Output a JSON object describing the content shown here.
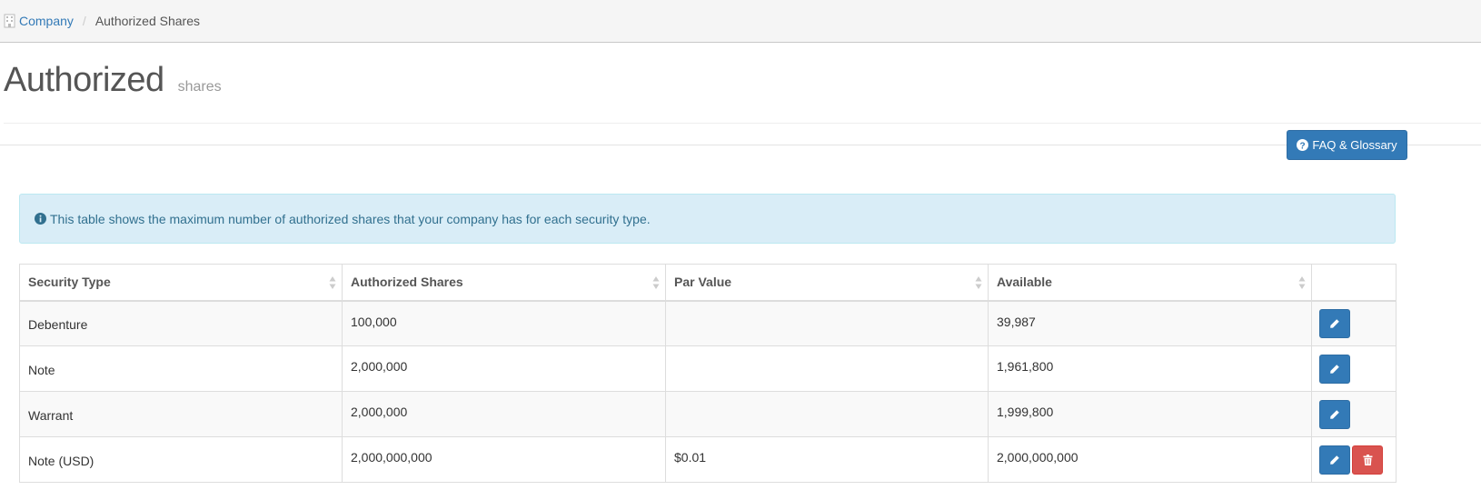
{
  "breadcrumb": {
    "icon": "building-icon",
    "company_label": "Company",
    "separator": "/",
    "current_label": "Authorized Shares"
  },
  "page": {
    "title": "Authorized",
    "subtitle": "shares"
  },
  "faq_button": {
    "icon": "question-circle-icon",
    "label": "FAQ & Glossary"
  },
  "info_alert": {
    "icon": "info-circle-icon",
    "text": "This table shows the maximum number of authorized shares that your company has for each security type."
  },
  "table": {
    "columns": [
      "Security Type",
      "Authorized Shares",
      "Par Value",
      "Available",
      ""
    ],
    "rows": [
      {
        "security_type": "Debenture",
        "authorized_shares": "100,000",
        "par_value": "",
        "available": "39,987",
        "actions": [
          "edit"
        ]
      },
      {
        "security_type": "Note",
        "authorized_shares": "2,000,000",
        "par_value": "",
        "available": "1,961,800",
        "actions": [
          "edit"
        ]
      },
      {
        "security_type": "Warrant",
        "authorized_shares": "2,000,000",
        "par_value": "",
        "available": "1,999,800",
        "actions": [
          "edit"
        ]
      },
      {
        "security_type": "Note (USD)",
        "authorized_shares": "2,000,000,000",
        "par_value": "$0.01",
        "available": "2,000,000,000",
        "actions": [
          "edit",
          "delete"
        ]
      }
    ]
  },
  "colors": {
    "primary": "#337ab7",
    "danger": "#d9534f",
    "info_bg": "#d9edf7",
    "info_text": "#31708f"
  }
}
